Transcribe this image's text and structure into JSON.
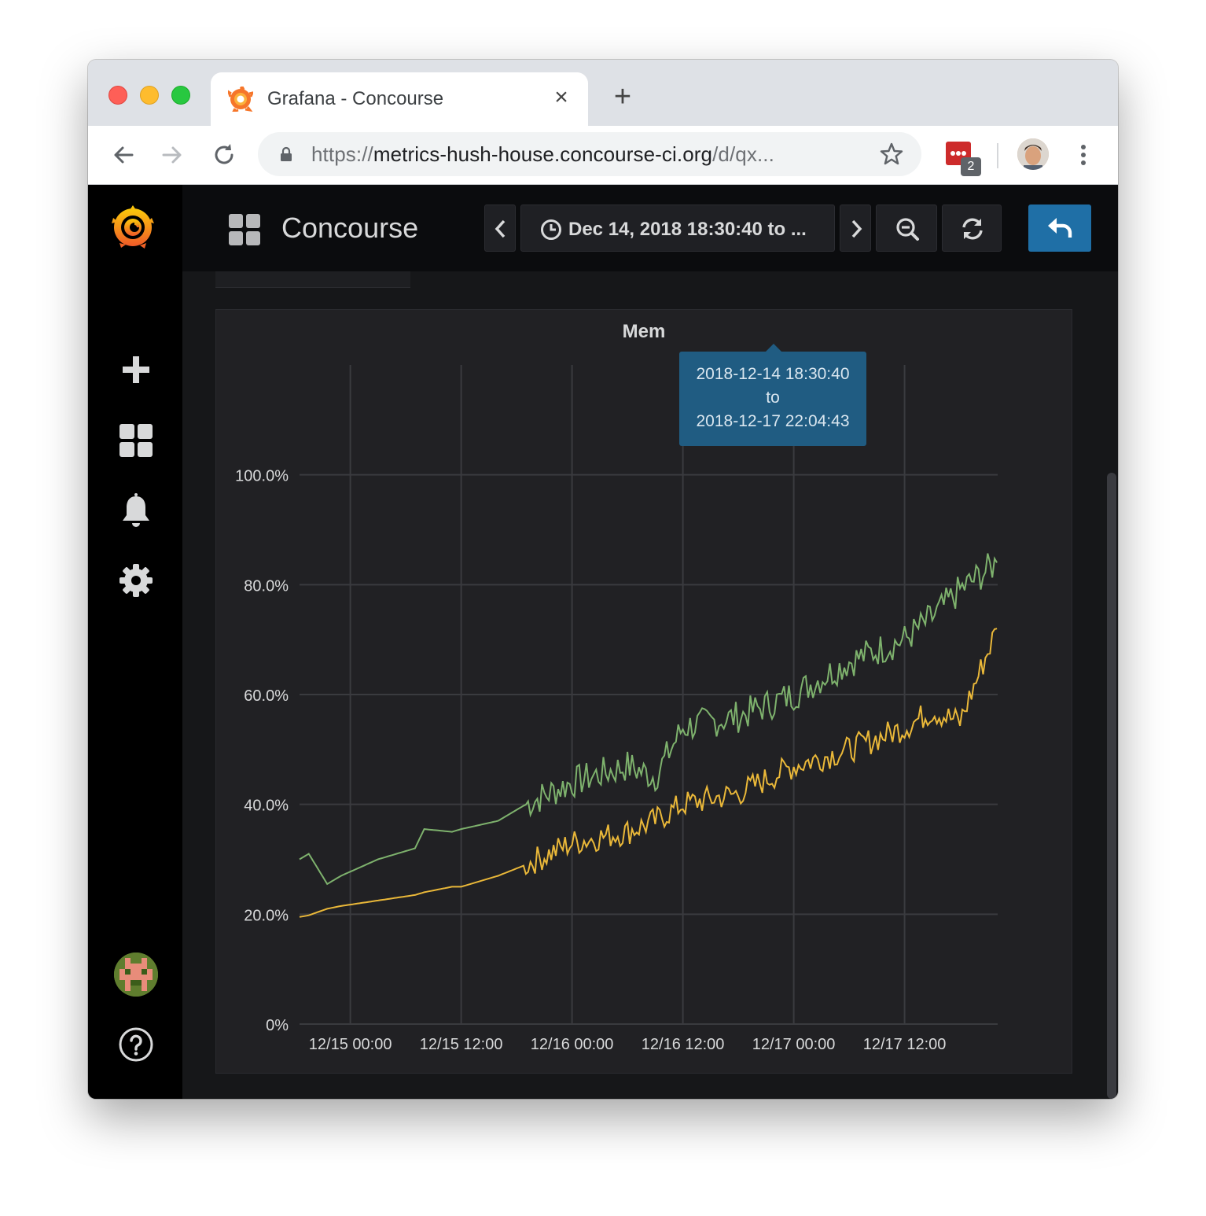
{
  "browser": {
    "tab_title": "Grafana - Concourse",
    "tab_close_glyph": "×",
    "new_tab_glyph": "+",
    "url_scheme": "https://",
    "url_host": "metrics-hush-house.concourse-ci.org",
    "url_path": "/d/qx...",
    "extension_badge": "2",
    "icons": [
      "back-icon",
      "forward-icon",
      "reload-icon",
      "lock-icon",
      "star-icon",
      "extension-icon",
      "profile-avatar",
      "menu-icon"
    ]
  },
  "sidebar": {
    "icons": [
      "grafana-logo",
      "plus-icon",
      "dashboards-icon",
      "bell-icon",
      "gear-icon",
      "user-avatar",
      "help-icon"
    ]
  },
  "navbar": {
    "dashboard_title": "Concourse",
    "time_range_label": "Dec 14, 2018 18:30:40 to ...",
    "icons": [
      "dashboard-grid-icon",
      "chevron-left-icon",
      "clock-icon",
      "chevron-right-icon",
      "zoom-out-icon",
      "refresh-icon",
      "back-arrow-icon"
    ]
  },
  "tooltip": {
    "from": "2018-12-14 18:30:40",
    "to_word": "to",
    "to": "2018-12-17 22:04:43"
  },
  "panel": {
    "title_visible": "Mem"
  },
  "colors": {
    "green_series": "#7eb26d",
    "yellow_series": "#eab839",
    "accent": "#1f6fa6"
  },
  "chart_data": {
    "type": "line",
    "title": "Mem",
    "y_ticks": [
      "0%",
      "20.0%",
      "40.0%",
      "60.0%",
      "80.0%",
      "100.0%"
    ],
    "x_ticks": [
      "12/15 00:00",
      "12/15 12:00",
      "12/16 00:00",
      "12/16 12:00",
      "12/17 00:00",
      "12/17 12:00"
    ],
    "ylim": [
      0,
      120
    ],
    "x": [
      "2018-12-14 18:30",
      "2018-12-14 19:30",
      "2018-12-14 21:30",
      "2018-12-14 23:00",
      "2018-12-15 03:00",
      "2018-12-15 07:00",
      "2018-12-15 08:00",
      "2018-12-15 11:00",
      "2018-12-15 12:00",
      "2018-12-15 16:00",
      "2018-12-15 19:00",
      "2018-12-16 00:00",
      "2018-12-16 06:00",
      "2018-12-16 09:00",
      "2018-12-16 12:00",
      "2018-12-16 18:00",
      "2018-12-17 00:00",
      "2018-12-17 06:00",
      "2018-12-17 12:00",
      "2018-12-17 15:00",
      "2018-12-17 18:00",
      "2018-12-17 22:00"
    ],
    "series": [
      {
        "values": [
          30,
          31,
          25.5,
          27,
          30,
          32,
          35.5,
          35,
          35.5,
          37,
          40,
          44,
          47,
          45,
          54,
          56,
          60,
          66,
          70,
          74,
          79,
          84
        ]
      },
      {
        "values": [
          19.5,
          19.8,
          21,
          21.5,
          22.5,
          23.5,
          24,
          25,
          25,
          27,
          29,
          33,
          35,
          37,
          40,
          42,
          47,
          50,
          54,
          57,
          55,
          72
        ]
      }
    ],
    "grid": true,
    "legend": "none"
  }
}
